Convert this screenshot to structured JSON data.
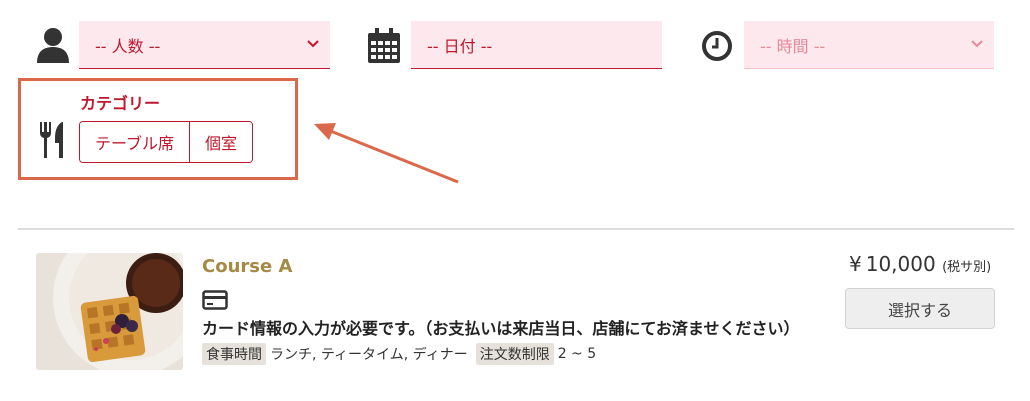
{
  "filters": {
    "people": {
      "placeholder": "-- 人数 --"
    },
    "date": {
      "placeholder": "-- 日付 --"
    },
    "time": {
      "placeholder": "-- 時間 --"
    }
  },
  "category": {
    "title": "カテゴリー",
    "options": [
      "テーブル席",
      "個室"
    ]
  },
  "course": {
    "title": "Course A",
    "notice": "カード情報の入力が必要です。（お支払いは来店当日、店舗にてお済ませください）",
    "tags": [
      {
        "label": "食事時間",
        "value": "ランチ, ティータイム, ディナー"
      },
      {
        "label": "注文数制限",
        "value": "2 ~ 5"
      }
    ],
    "price": "10,000",
    "currency": "¥",
    "tax_note": "(税サ別)",
    "select_label": "選択する"
  },
  "colors": {
    "accent": "#c0172d",
    "field_bg": "#fde9ed",
    "highlight_box": "#d9694a",
    "course_title": "#a58a43"
  },
  "icons": [
    "person-icon",
    "calendar-icon",
    "clock-icon",
    "cutlery-icon",
    "credit-card-icon",
    "chevron-down-icon",
    "annotation-arrow"
  ]
}
